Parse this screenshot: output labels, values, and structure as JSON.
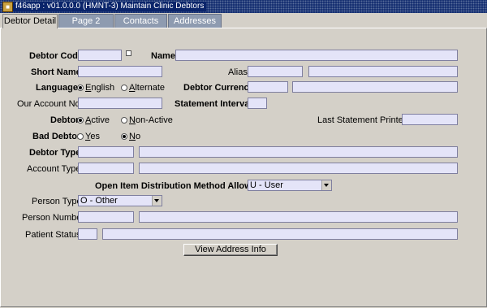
{
  "window": {
    "title": "f46app : v01.0.0.0 (HMNT-3) Maintain Clinic Debtors"
  },
  "tabs": [
    {
      "label": "Debtor Detail"
    },
    {
      "label": "Page 2"
    },
    {
      "label": "Contacts"
    },
    {
      "label": "Addresses"
    }
  ],
  "form": {
    "debtor_code": {
      "label": "Debtor Code",
      "value": ""
    },
    "name": {
      "label": "Name",
      "value": ""
    },
    "short_name": {
      "label": "Short Name",
      "value": ""
    },
    "alias": {
      "label": "Alias",
      "value": "",
      "value2": ""
    },
    "language": {
      "label": "Language",
      "options": [
        "English",
        "Alternate"
      ],
      "selected": "English"
    },
    "debtor_currency": {
      "label": "Debtor Currency",
      "value": "",
      "value2": ""
    },
    "our_account_no": {
      "label": "Our Account No.",
      "value": ""
    },
    "statement_interval": {
      "label": "Statement Interval",
      "value": ""
    },
    "debtor_status": {
      "label": "Debtor",
      "options": [
        "Active",
        "Non-Active"
      ],
      "selected": "Active"
    },
    "last_statement_printed": {
      "label": "Last Statement Printed",
      "value": ""
    },
    "bad_debtor": {
      "label": "Bad Debtor",
      "options": [
        "Yes",
        "No"
      ],
      "selected": "No"
    },
    "debtor_type": {
      "label": "Debtor Type",
      "value": "",
      "value2": ""
    },
    "account_type": {
      "label": "Account Type",
      "value": "",
      "value2": ""
    },
    "open_item": {
      "label": "Open Item Distribution Method Allowed",
      "value": "U - User"
    },
    "person_type": {
      "label": "Person Type",
      "value": "O - Other"
    },
    "person_number": {
      "label": "Person Number",
      "value": "",
      "value2": ""
    },
    "patient_status": {
      "label": "Patient Status",
      "value": "",
      "value2": ""
    },
    "view_address_button": {
      "label": "View  Address Info"
    }
  }
}
